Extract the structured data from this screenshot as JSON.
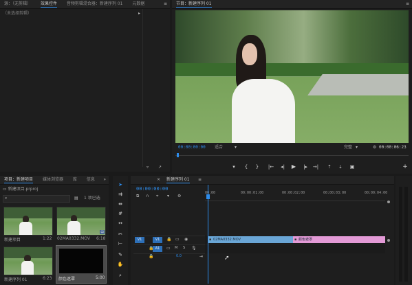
{
  "source_panel": {
    "tabs": [
      "源：（无剪辑）",
      "效果控件",
      "音频剪辑混合器：新建序列 01",
      "元数据"
    ],
    "active_tab": 1,
    "no_clip_text": "（未选择剪辑）"
  },
  "program_monitor": {
    "title": "节目：新建序列 01",
    "timecode_left": "00:00:00:00",
    "fit_label": "适合",
    "quality_label": "完整",
    "timecode_right": "00:00:06:23"
  },
  "project_panel": {
    "tabs": [
      "项目：新建项目",
      "媒体浏览器",
      "库",
      "信息"
    ],
    "project_file": "新建项目.prproj",
    "item_count": "1 项已选",
    "items": [
      {
        "name": "新建项目",
        "duration": "1:22"
      },
      {
        "name": "02MA0332.MOV",
        "duration": "6:18"
      },
      {
        "name": "新建序列 01",
        "duration": "6:23"
      },
      {
        "name": "颜色遮罩",
        "duration": "5:00"
      }
    ]
  },
  "timeline": {
    "tab": "新建序列 01",
    "timecode": "00:00:00:00",
    "ruler": [
      "00:00",
      "00:00:01:00",
      "00:00:02:00",
      "00:00:03:00",
      "00:00:04:00"
    ],
    "tracks": [
      {
        "source": "V1",
        "target": "V1"
      },
      {
        "source": "A1",
        "target": "A1"
      }
    ],
    "master_value": "0.0",
    "clips": [
      {
        "label": "02MA0332.MOV",
        "color": "#6aa6d6",
        "start": 0.0,
        "end": 0.48
      },
      {
        "label": "颜色遮罩",
        "color": "#e39ad6",
        "start": 0.48,
        "end": 1.0
      }
    ]
  },
  "colors": {
    "accent": "#2d8ceb",
    "playhead": "#2d8ceb",
    "video_clip": "#6aa6d6",
    "matte_clip": "#e39ad6"
  }
}
